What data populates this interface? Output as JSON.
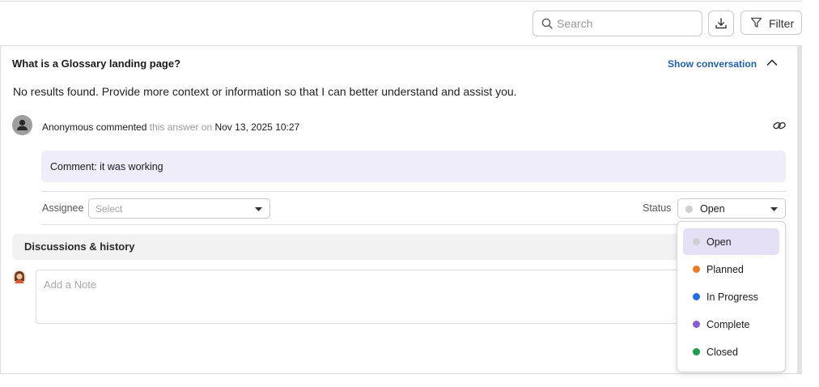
{
  "toolbar": {
    "search_placeholder": "Search",
    "filter_label": "Filter"
  },
  "question": {
    "title": "What is a Glossary landing page?",
    "show_conversation": "Show conversation",
    "answer": "No results found. Provide more context or information so that I can better understand and assist you."
  },
  "comment": {
    "author": "Anonymous commented",
    "context": "this answer on",
    "timestamp": "Nov 13, 2025 10:27",
    "body": "Comment: it was working"
  },
  "assignment": {
    "assignee_label": "Assignee",
    "assignee_placeholder": "Select",
    "status_label": "Status",
    "status_value": "Open"
  },
  "discussion": {
    "header": "Discussions & history",
    "note_placeholder": "Add a Note"
  },
  "status_options": [
    {
      "label": "Open",
      "color": "#cfcfcf",
      "selected": true
    },
    {
      "label": "Planned",
      "color": "#f07a28"
    },
    {
      "label": "In Progress",
      "color": "#1e6fe8"
    },
    {
      "label": "Complete",
      "color": "#8a5ad6"
    },
    {
      "label": "Closed",
      "color": "#1f9d4a"
    }
  ],
  "colors": {
    "accent_link": "#1f5fb5",
    "comment_bg": "#efedfa",
    "selected_option_bg": "#e6e0f6"
  }
}
